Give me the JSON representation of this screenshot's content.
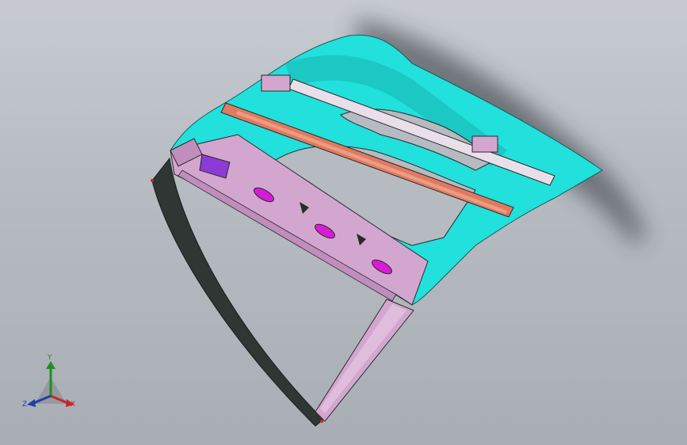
{
  "viewport": {
    "background_top": "#c7cbd1",
    "background_bottom": "#a9aeb5"
  },
  "model": {
    "colors": {
      "inner_panel": "#22e0dc",
      "inner_panel_shade": "#17b8b4",
      "outer_rail": "#d3a6cf",
      "highlight_magenta": "#d81bd8",
      "purple_bracket": "#8c3bd6",
      "crossbar_orange": "#e07a5f",
      "crossbar_bar": "#e8dfe8",
      "frame_black": "#2f3633",
      "edge_line": "#2a2a2a"
    }
  },
  "triad": {
    "y_label": "Y",
    "x_label": "X",
    "z_label": "Z",
    "y_color": "#1f8f1f",
    "x_color": "#c62828",
    "z_color": "#1f3fa8"
  }
}
